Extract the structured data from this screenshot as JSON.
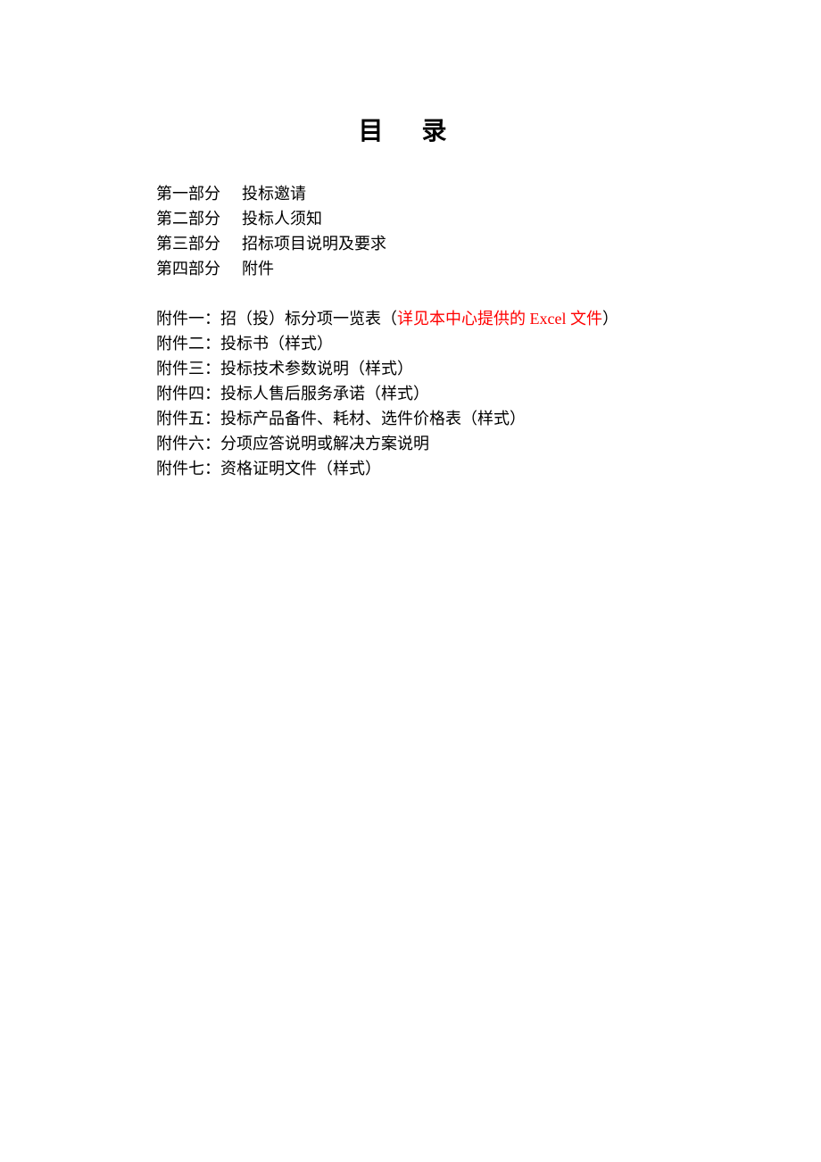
{
  "title": "目 录",
  "sections": [
    {
      "label": "第一部分",
      "name": "投标邀请"
    },
    {
      "label": "第二部分",
      "name": "投标人须知"
    },
    {
      "label": "第三部分",
      "name": "招标项目说明及要求"
    },
    {
      "label": "第四部分",
      "name": "附件"
    }
  ],
  "attachments": [
    {
      "prefix": "附件一：招（投）标分项一览表（",
      "highlight": "详见本中心提供的 Excel 文件",
      "suffix": "）"
    },
    {
      "prefix": "附件二：投标书（样式）",
      "highlight": "",
      "suffix": ""
    },
    {
      "prefix": "附件三：投标技术参数说明（样式）",
      "highlight": "",
      "suffix": ""
    },
    {
      "prefix": "附件四：投标人售后服务承诺（样式）",
      "highlight": "",
      "suffix": ""
    },
    {
      "prefix": "附件五：投标产品备件、耗材、选件价格表（样式）",
      "highlight": "",
      "suffix": ""
    },
    {
      "prefix": "附件六：分项应答说明或解决方案说明",
      "highlight": "",
      "suffix": ""
    },
    {
      "prefix": "附件七：资格证明文件（样式）",
      "highlight": "",
      "suffix": ""
    }
  ]
}
